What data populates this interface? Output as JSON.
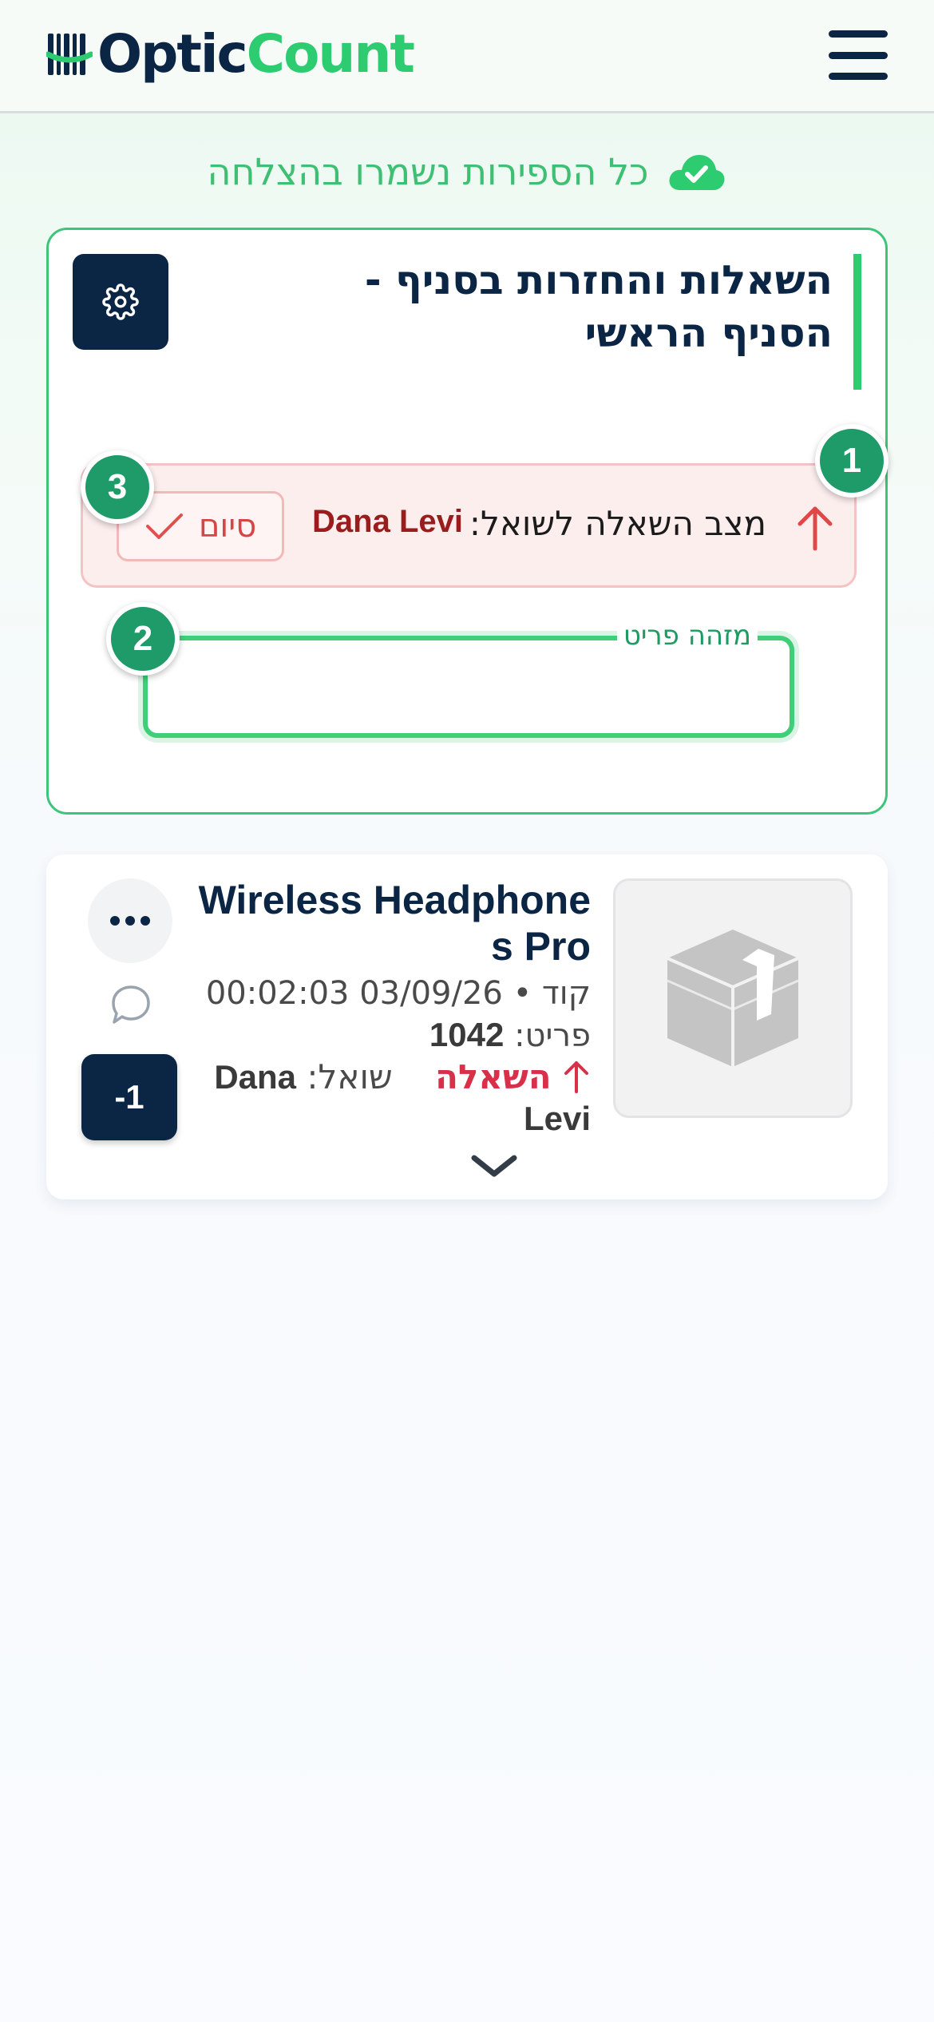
{
  "header": {
    "logo_part1": "Optic",
    "logo_part2": "Count",
    "menu_icon": "hamburger-menu-icon"
  },
  "sync": {
    "text": "כל הספירות נשמרו בהצלחה",
    "icon": "cloud-check-icon",
    "color": "#2ecc71"
  },
  "session": {
    "title": "השאלות והחזרות בסניף - הסניף הראשי",
    "settings_icon": "gear-icon",
    "status_label": "מצב השאלה לשואל:",
    "status_user": "Dana Levi",
    "finish_label": "סיום",
    "badges": [
      "1",
      "2",
      "3"
    ],
    "item_id_label": "מזהה פריט",
    "item_id_value": ""
  },
  "item": {
    "name": "Wireless Headphones Pro",
    "datetime": "03/09/26 00:02:03",
    "separator": "•",
    "code_label": "קוד",
    "item_label": "פריט:",
    "item_code": "1042",
    "action": "השאלה",
    "borrower_label": "שואל:",
    "borrower": "Dana Levi",
    "quantity_button": "-1",
    "image_icon": "package-box-icon"
  },
  "colors": {
    "brand_navy": "#0b2545",
    "brand_green": "#2ecc71",
    "badge_green": "#1e9b68",
    "danger_red": "#d9304a"
  }
}
